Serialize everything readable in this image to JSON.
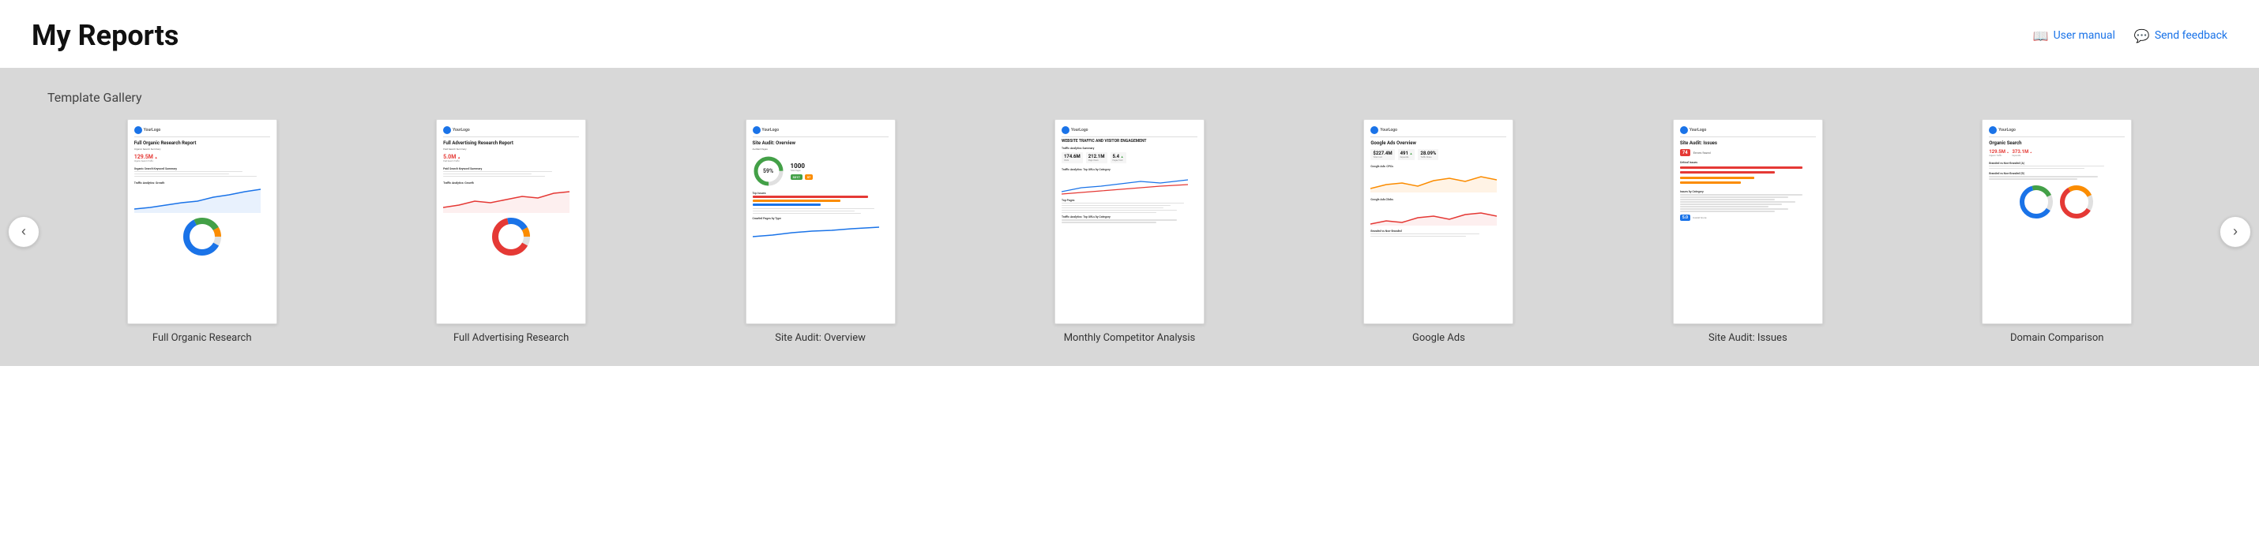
{
  "header": {
    "title": "My Reports",
    "actions": [
      {
        "id": "user-manual",
        "label": "User manual",
        "icon": "book-icon"
      },
      {
        "id": "send-feedback",
        "label": "Send feedback",
        "icon": "chat-icon"
      }
    ]
  },
  "gallery": {
    "section_title": "Template Gallery",
    "carousel_prev": "‹",
    "carousel_next": "›",
    "templates": [
      {
        "id": "full-organic-research",
        "label": "Full Organic Research",
        "type": "organic"
      },
      {
        "id": "full-advertising-research",
        "label": "Full Advertising Research",
        "type": "advertising"
      },
      {
        "id": "site-audit-overview",
        "label": "Site Audit: Overview",
        "type": "audit-overview"
      },
      {
        "id": "monthly-competitor-analysis",
        "label": "Monthly Competitor Analysis",
        "type": "competitor"
      },
      {
        "id": "google-ads",
        "label": "Google Ads",
        "type": "google-ads"
      },
      {
        "id": "site-audit-issues",
        "label": "Site Audit: Issues",
        "type": "audit-issues"
      },
      {
        "id": "domain-comparison",
        "label": "Domain Comparison",
        "type": "domain-comparison"
      }
    ]
  }
}
